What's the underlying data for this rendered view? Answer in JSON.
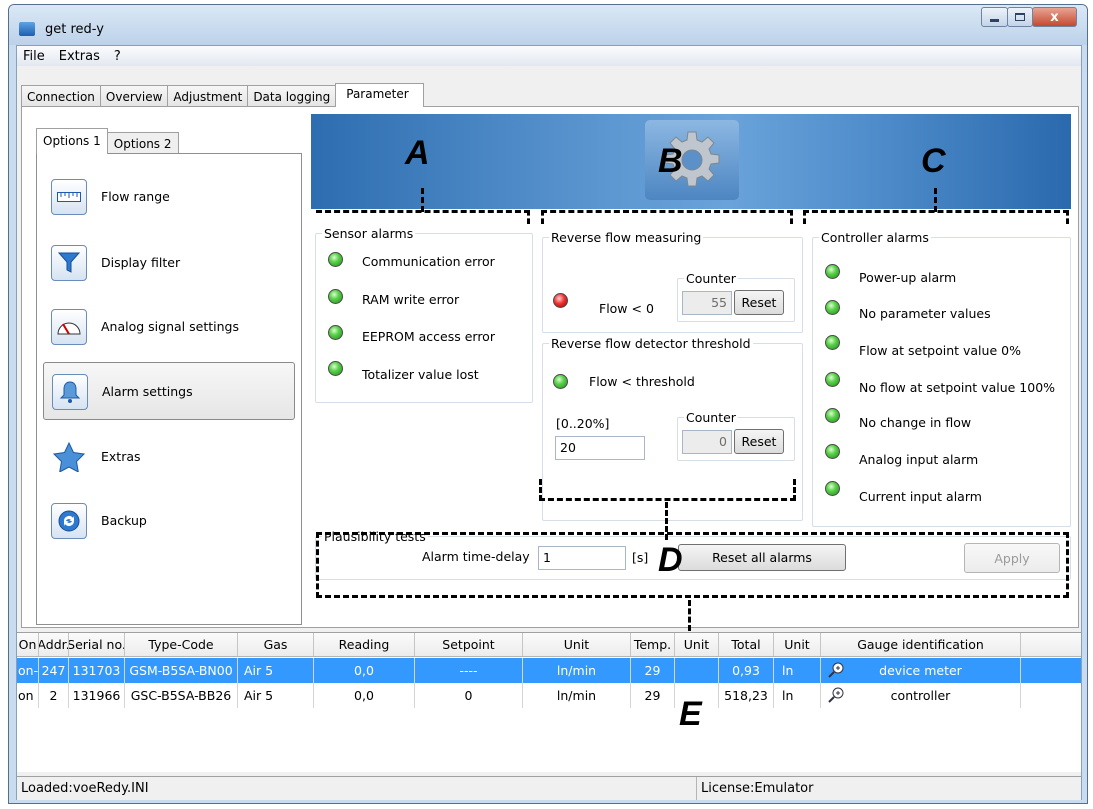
{
  "window": {
    "title": "get red-y",
    "close_glyph": "x"
  },
  "menu": [
    "File",
    "Extras",
    "?"
  ],
  "tabs": [
    "Connection",
    "Overview",
    "Adjustment",
    "Data logging",
    "Parameter"
  ],
  "options_tabs": [
    "Options 1",
    "Options 2"
  ],
  "options_items": [
    {
      "label": "Flow range",
      "icon": "ruler-icon"
    },
    {
      "label": "Display filter",
      "icon": "funnel-icon"
    },
    {
      "label": "Analog signal settings",
      "icon": "gauge-icon"
    },
    {
      "label": "Alarm settings",
      "icon": "bell-icon"
    },
    {
      "label": "Extras",
      "icon": "star-icon"
    },
    {
      "label": "Backup",
      "icon": "backup-icon"
    }
  ],
  "annotations": [
    "A",
    "B",
    "C",
    "D",
    "E"
  ],
  "sensor_alarms": {
    "title": "Sensor alarms",
    "items": [
      "Communication error",
      "RAM write error",
      "EEPROM access error",
      "Totalizer value lost"
    ]
  },
  "reverse_flow": {
    "title": "Reverse flow measuring",
    "flow_label": "Flow < 0",
    "counter_label": "Counter",
    "counter_value": "55",
    "reset_label": "Reset"
  },
  "reverse_threshold": {
    "title": "Reverse flow detector threshold",
    "flow_label": "Flow < threshold",
    "range_label": "[0..20%]",
    "value": "20",
    "counter_label": "Counter",
    "counter_value": "0",
    "reset_label": "Reset"
  },
  "controller_alarms": {
    "title": "Controller alarms",
    "items": [
      "Power-up alarm",
      "No parameter values",
      "Flow at setpoint value 0%",
      "No flow at setpoint value 100%",
      "No change in flow",
      "Analog input alarm",
      "Current input alarm"
    ]
  },
  "plausibility": {
    "title": "Plausibility tests",
    "delay_label": "Alarm time-delay",
    "delay_value": "1",
    "unit": "[s]",
    "reset_all_label": "Reset all alarms",
    "apply_label": "Apply"
  },
  "grid": {
    "columns": [
      "On",
      "Addr.",
      "Serial no.",
      "Type-Code",
      "Gas",
      "Reading",
      "Setpoint",
      "Unit",
      "Temp.",
      "Unit",
      "Total",
      "Unit",
      "Gauge identification"
    ],
    "rows": [
      [
        "on-",
        "247",
        "131703",
        "GSM-B5SA-BN00",
        "Air 5",
        "0,0",
        "----",
        "ln/min",
        "29",
        "",
        "0,93",
        "ln",
        "device meter"
      ],
      [
        "on",
        "2",
        "131966",
        "GSC-B5SA-BB26",
        "Air 5",
        "0,0",
        "0",
        "ln/min",
        "29",
        "",
        "518,23",
        "ln",
        "controller"
      ]
    ]
  },
  "status": {
    "left": "Loaded:voeRedy.INI",
    "right": "License:Emulator"
  },
  "colors": {
    "led_green": "#3cbf3a",
    "led_red": "#e02020",
    "selection": "#3399ff",
    "banner": "#4a87c6"
  }
}
